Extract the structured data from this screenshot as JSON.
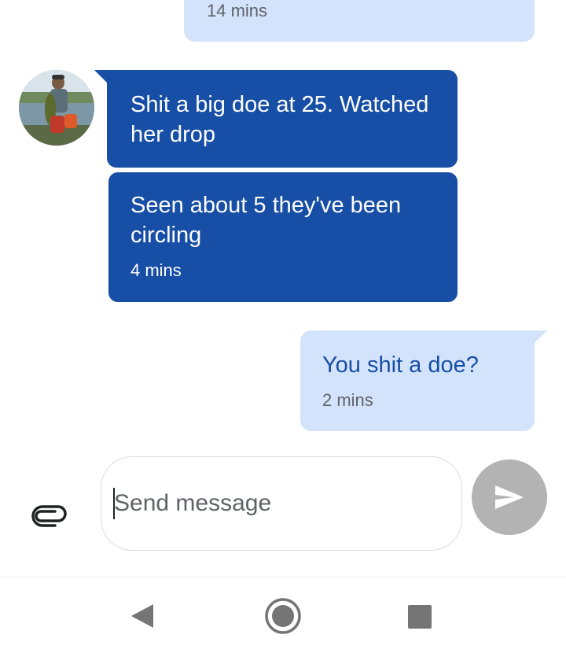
{
  "conversation": {
    "messages": [
      {
        "direction": "outgoing",
        "text": "",
        "time": "14 mins"
      },
      {
        "direction": "incoming",
        "text": "Shit a big doe at 25. Watched her drop",
        "time": ""
      },
      {
        "direction": "incoming",
        "text": "Seen about 5 they've been circling",
        "time": "4 mins"
      },
      {
        "direction": "outgoing",
        "text": "You shit a doe?",
        "time": "2 mins"
      }
    ]
  },
  "compose": {
    "placeholder": "Send message",
    "attach_icon": "paperclip-icon",
    "send_icon": "send-icon"
  },
  "navbar": {
    "back_icon": "back-triangle-icon",
    "home_icon": "home-circle-icon",
    "recent_icon": "recent-square-icon"
  },
  "colors": {
    "incoming_bubble": "#174ea6",
    "outgoing_bubble": "#d3e3fb",
    "outgoing_text": "#174ea6",
    "send_button": "#b3b3b3"
  }
}
